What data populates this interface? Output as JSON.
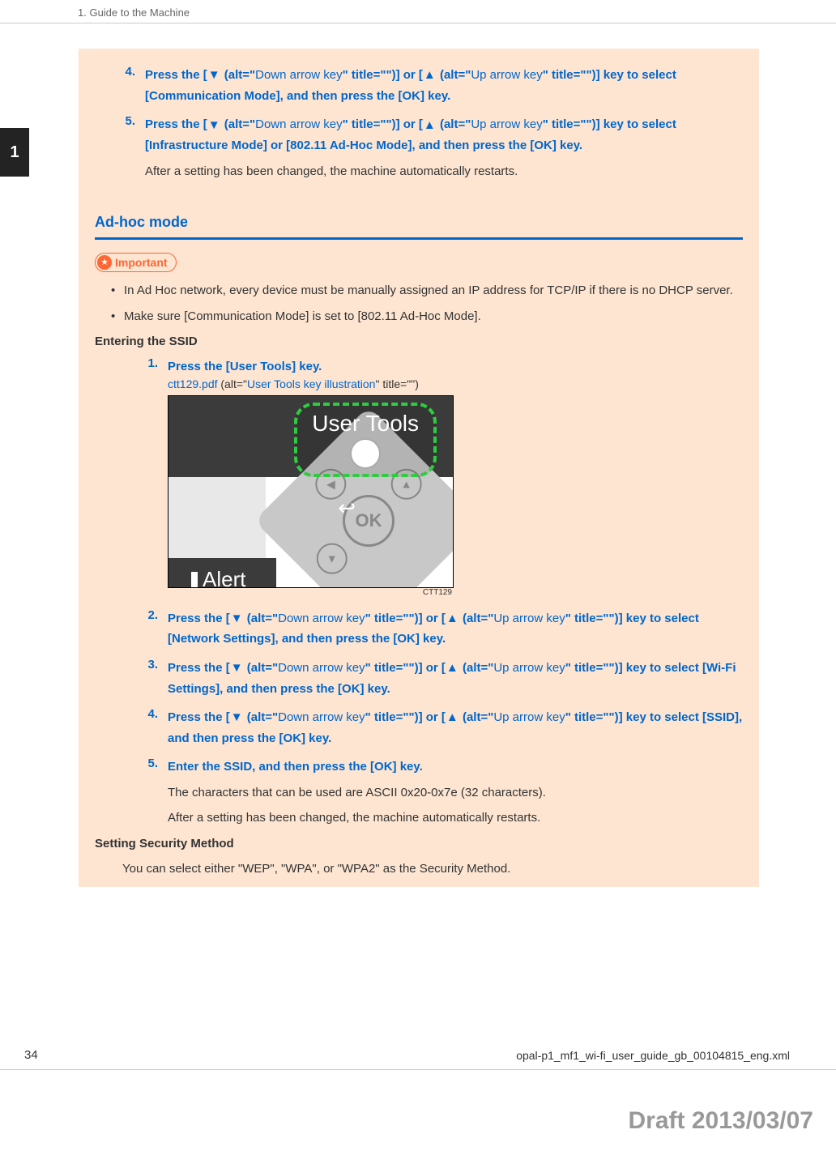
{
  "header": "1. Guide to the Machine",
  "chapter_tab": "1",
  "top_steps": [
    {
      "num": "4.",
      "text_parts": [
        "Press the [",
        "▼",
        " (alt=\"",
        "Down arrow key",
        "\" title=\"\")] or [",
        "▲",
        " (alt=\"",
        "Up arrow key",
        "\" title=\"\")] key to select [Communication Mode], and then press the [OK] key."
      ],
      "note": null
    },
    {
      "num": "5.",
      "text_parts": [
        "Press the [",
        "▼",
        " (alt=\"",
        "Down arrow key",
        "\" title=\"\")] or [",
        "▲",
        " (alt=\"",
        "Up arrow key",
        "\" title=\"\")] key to select [Infrastructure Mode] or [802.11 Ad-Hoc Mode], and then press the [OK] key."
      ],
      "note": "After a setting has been changed, the machine automatically restarts."
    }
  ],
  "section_title": "Ad-hoc mode",
  "important_label": "Important",
  "important_bullets": [
    "In Ad Hoc network, every device must be manually assigned an IP address for TCP/IP if there is no DHCP server.",
    "Make sure [Communication Mode] is set to [802.11 Ad-Hoc Mode]."
  ],
  "subhead_ssid": "Entering the SSID",
  "ssid_step1": {
    "num": "1.",
    "text": "Press the [User Tools] key.",
    "link_fname": "ctt129.pdf",
    "link_rest_open": " (alt=\"",
    "link_alt": "User Tools key illustration",
    "link_rest_close": "\" title=\"\")"
  },
  "figure": {
    "user_tools": "User Tools",
    "ok": "OK",
    "alert": "Alert",
    "caption": "CTT129"
  },
  "ssid_rest_steps": [
    {
      "num": "2.",
      "text_parts": [
        "Press the [",
        "▼",
        " (alt=\"",
        "Down arrow key",
        "\" title=\"\")] or [",
        "▲",
        " (alt=\"",
        "Up arrow key",
        "\" title=\"\")] key to select [Network Settings], and then press the [OK] key."
      ],
      "note": null
    },
    {
      "num": "3.",
      "text_parts": [
        "Press the [",
        "▼",
        " (alt=\"",
        "Down arrow key",
        "\" title=\"\")] or [",
        "▲",
        " (alt=\"",
        "Up arrow key",
        "\" title=\"\")] key to select [Wi-Fi Settings], and then press the [OK] key."
      ],
      "note": null
    },
    {
      "num": "4.",
      "text_parts": [
        "Press the [",
        "▼",
        " (alt=\"",
        "Down arrow key",
        "\" title=\"\")] or [",
        "▲",
        " (alt=\"",
        "Up arrow key",
        "\" title=\"\")] key to select [SSID], and then press the [OK] key."
      ],
      "note": null
    },
    {
      "num": "5.",
      "text_parts": [
        "Enter the SSID, and then press the [OK] key."
      ],
      "note": "The characters that can be used are ASCII 0x20-0x7e (32 characters).",
      "note2": "After a setting has been changed, the machine automatically restarts."
    }
  ],
  "subhead_security": "Setting Security Method",
  "security_text": "You can select either \"WEP\", \"WPA\", or \"WPA2\" as the Security Method.",
  "page_num": "34",
  "footer_file": "opal-p1_mf1_wi-fi_user_guide_gb_00104815_eng.xml",
  "draft": "Draft 2013/03/07"
}
